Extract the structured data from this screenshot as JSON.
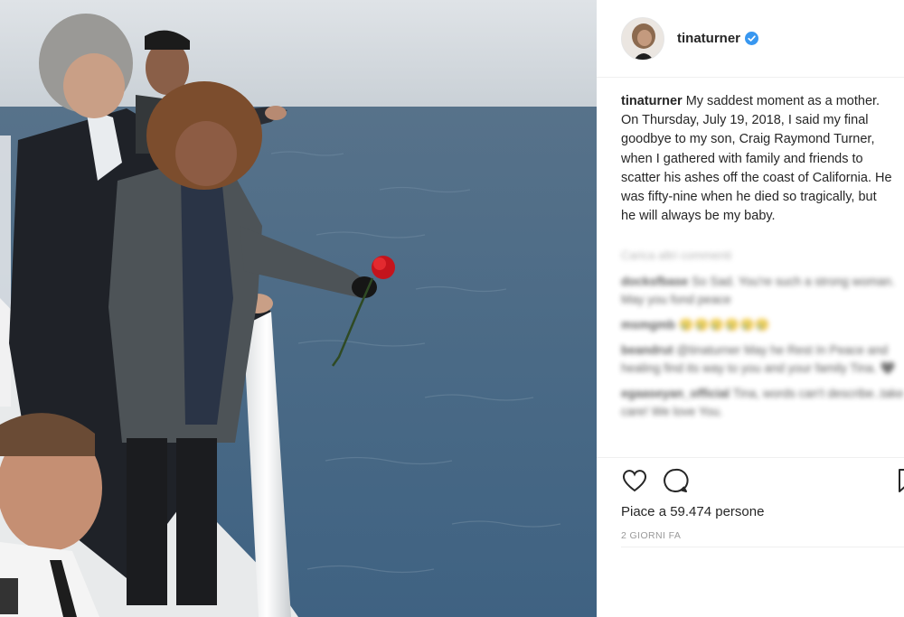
{
  "post": {
    "username": "tinaturner",
    "verified_icon": "verified-badge-icon",
    "caption_user": "tinaturner",
    "caption_text": " My saddest moment as a mother. On Thursday, July 19, 2018, I said my final goodbye to my son, Craig Raymond Turner, when I gathered with family and friends to scatter his ashes off the coast of California. He was fifty-nine when he died so tragically, but he will always be my baby.",
    "load_more": "Carica altri commenti",
    "comments": [
      {
        "user": "docksfbase",
        "text": "So Sad. You're such a strong woman. May you fond peace"
      },
      {
        "user": "msmgmb",
        "text": "😢😢😢😢😢😢"
      },
      {
        "user": "beandrut",
        "text": "@tinaturner May he Rest In Peace and healing find its way to you and your family Tina. 🖤"
      },
      {
        "user": "egaaseyan_official",
        "text": "Tina, words can't describe..take care! We love You."
      }
    ],
    "likes_text": "Piace a 59.474 persone",
    "date_text": "2 GIORNI FA"
  },
  "icons": {
    "like": "heart-icon",
    "comment": "comment-bubble-icon",
    "save": "bookmark-icon"
  },
  "colors": {
    "verified_blue": "#3897f0",
    "text": "#262626",
    "muted": "#999999",
    "border": "#efefef"
  }
}
